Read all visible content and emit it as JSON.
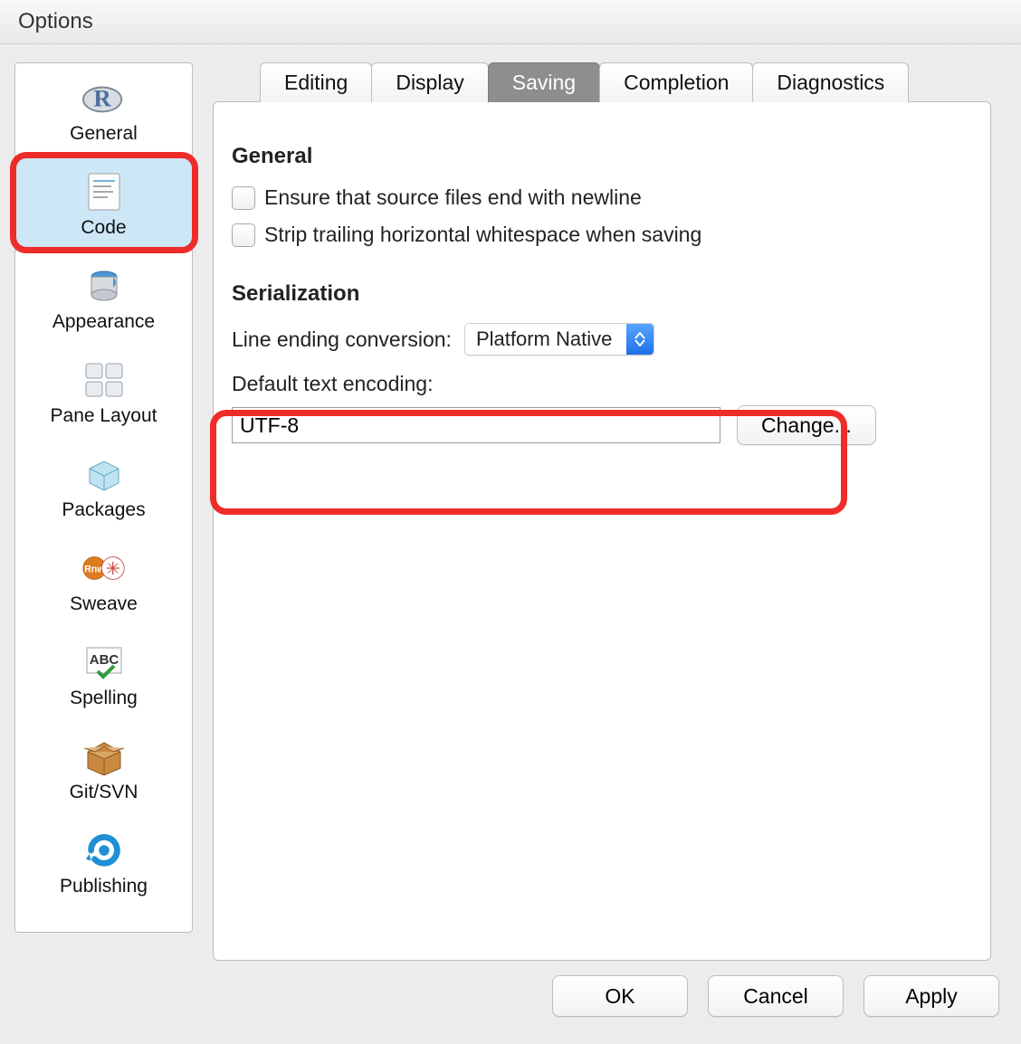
{
  "window": {
    "title": "Options"
  },
  "sidebar": {
    "items": [
      {
        "label": "General"
      },
      {
        "label": "Code"
      },
      {
        "label": "Appearance"
      },
      {
        "label": "Pane Layout"
      },
      {
        "label": "Packages"
      },
      {
        "label": "Sweave"
      },
      {
        "label": "Spelling"
      },
      {
        "label": "Git/SVN"
      },
      {
        "label": "Publishing"
      }
    ],
    "selected_index": 1
  },
  "tabs": {
    "items": [
      {
        "label": "Editing"
      },
      {
        "label": "Display"
      },
      {
        "label": "Saving"
      },
      {
        "label": "Completion"
      },
      {
        "label": "Diagnostics"
      }
    ],
    "active_index": 2
  },
  "panel": {
    "sections": {
      "general": {
        "title": "General",
        "ensure_newline": {
          "label": "Ensure that source files end with newline",
          "checked": false
        },
        "strip_ws": {
          "label": "Strip trailing horizontal whitespace when saving",
          "checked": false
        }
      },
      "serialization": {
        "title": "Serialization",
        "line_ending_label": "Line ending conversion:",
        "line_ending_value": "Platform Native",
        "encoding_label": "Default text encoding:",
        "encoding_value": "UTF-8",
        "change_button": "Change..."
      }
    }
  },
  "footer": {
    "ok": "OK",
    "cancel": "Cancel",
    "apply": "Apply"
  }
}
